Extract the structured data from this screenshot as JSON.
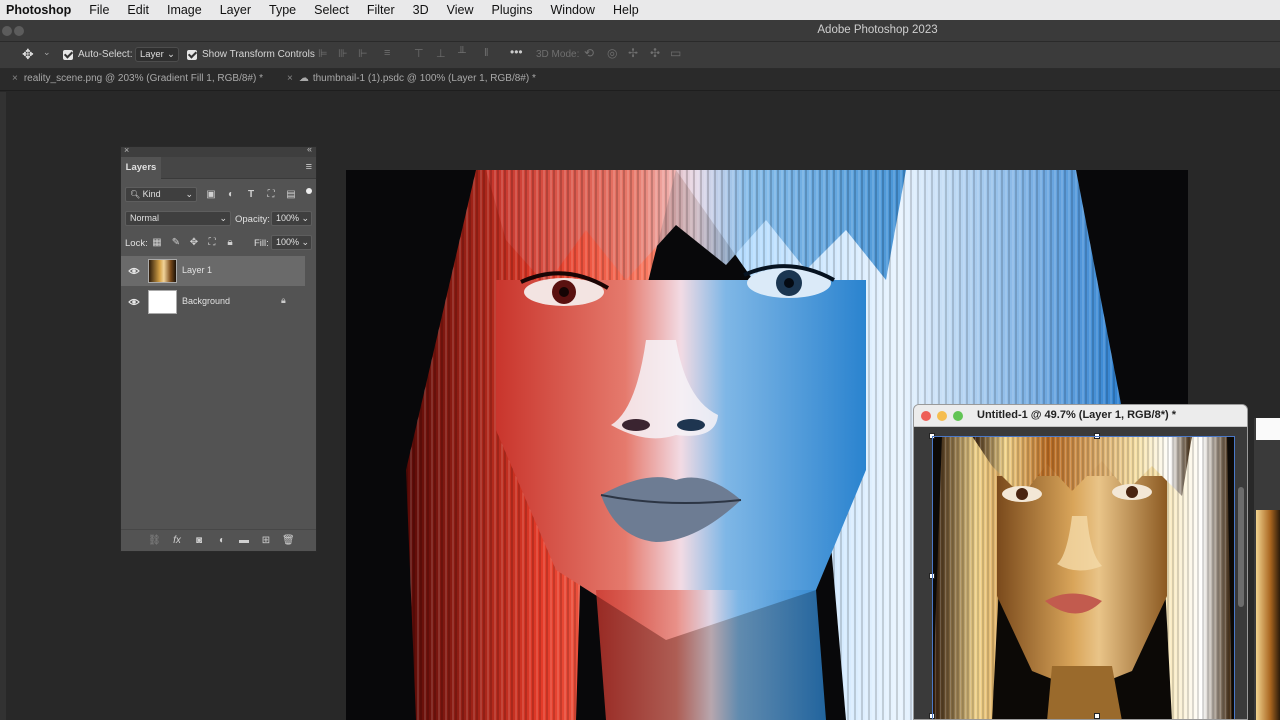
{
  "menubar": {
    "app": "Photoshop",
    "items": [
      "File",
      "Edit",
      "Image",
      "Layer",
      "Type",
      "Select",
      "Filter",
      "3D",
      "View",
      "Plugins",
      "Window",
      "Help"
    ]
  },
  "window": {
    "title": "Adobe Photoshop 2023"
  },
  "options_bar": {
    "auto_select_label": "Auto-Select:",
    "auto_select_value": "Layer",
    "show_transform_label": "Show Transform Controls",
    "mode_3d_label": "3D Mode:"
  },
  "tabs": [
    {
      "label": "reality_scene.png @ 203% (Gradient Fill 1, RGB/8#) *"
    },
    {
      "label": "thumbnail-1 (1).psdc @ 100% (Layer 1, RGB/8#) *"
    }
  ],
  "layers_panel": {
    "title": "Layers",
    "filter_kind": "Kind",
    "blend_mode": "Normal",
    "opacity_label": "Opacity:",
    "opacity_value": "100%",
    "lock_label": "Lock:",
    "fill_label": "Fill:",
    "fill_value": "100%",
    "layers": [
      {
        "name": "Layer 1"
      },
      {
        "name": "Background"
      }
    ]
  },
  "float_window": {
    "title": "Untitled-1 @ 49.7% (Layer 1, RGB/8*) *"
  },
  "colors": {
    "traffic_red": "#ee5f57",
    "traffic_yellow": "#f5bd4f",
    "traffic_green": "#61c454"
  }
}
